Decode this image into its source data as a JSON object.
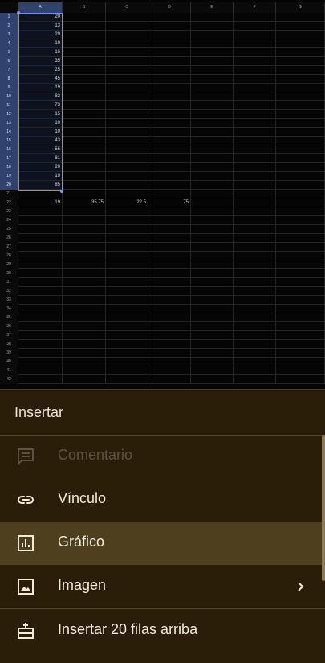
{
  "sheet": {
    "columns": [
      "A",
      "B",
      "C",
      "D",
      "E",
      "F",
      "G"
    ],
    "rows": [
      {
        "n": "1",
        "a": "20"
      },
      {
        "n": "2",
        "a": "13"
      },
      {
        "n": "3",
        "a": "29"
      },
      {
        "n": "4",
        "a": "19"
      },
      {
        "n": "5",
        "a": "16"
      },
      {
        "n": "6",
        "a": "35"
      },
      {
        "n": "7",
        "a": "25"
      },
      {
        "n": "8",
        "a": "45"
      },
      {
        "n": "9",
        "a": "19"
      },
      {
        "n": "10",
        "a": "82"
      },
      {
        "n": "11",
        "a": "73"
      },
      {
        "n": "12",
        "a": "15"
      },
      {
        "n": "13",
        "a": "10"
      },
      {
        "n": "14",
        "a": "10"
      },
      {
        "n": "15",
        "a": "43"
      },
      {
        "n": "16",
        "a": "56"
      },
      {
        "n": "17",
        "a": "81"
      },
      {
        "n": "18",
        "a": "20"
      },
      {
        "n": "19",
        "a": "19"
      },
      {
        "n": "20",
        "a": "85"
      },
      {
        "n": "21"
      },
      {
        "n": "22",
        "a": "19",
        "b": "35.75",
        "c": "22.5",
        "d": "75"
      },
      {
        "n": "23"
      },
      {
        "n": "24"
      },
      {
        "n": "25"
      },
      {
        "n": "26"
      },
      {
        "n": "27"
      },
      {
        "n": "28"
      },
      {
        "n": "29"
      },
      {
        "n": "30"
      },
      {
        "n": "31"
      },
      {
        "n": "32"
      },
      {
        "n": "33"
      },
      {
        "n": "34"
      },
      {
        "n": "35"
      },
      {
        "n": "36"
      },
      {
        "n": "37"
      },
      {
        "n": "38"
      },
      {
        "n": "39"
      },
      {
        "n": "40"
      },
      {
        "n": "41"
      },
      {
        "n": "42"
      }
    ],
    "selected_column": "A",
    "selected_row_count": 20,
    "accent_color": "#6f8fe8"
  },
  "menu": {
    "title": "Insertar",
    "items": [
      {
        "label": "Comentario",
        "icon": "comment-icon",
        "enabled": false
      },
      {
        "label": "Vínculo",
        "icon": "link-icon",
        "enabled": true
      },
      {
        "label": "Gráfico",
        "icon": "chart-icon",
        "enabled": true,
        "highlighted": true
      },
      {
        "label": "Imagen",
        "icon": "image-icon",
        "enabled": true,
        "has_submenu": true
      },
      {
        "label": "Insertar 20 filas arriba",
        "icon": "insert-rows-above-icon",
        "enabled": true
      }
    ]
  }
}
